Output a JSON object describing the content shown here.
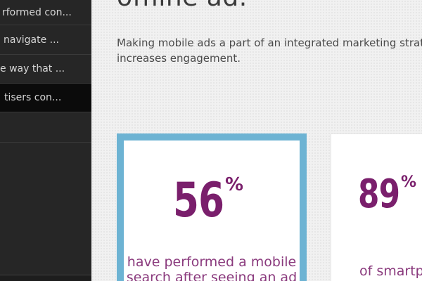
{
  "sidebar": {
    "items": [
      {
        "label": "rformed con..."
      },
      {
        "label": "navigate ..."
      },
      {
        "label": "e way that ..."
      },
      {
        "label": "tisers con...",
        "active": true
      },
      {
        "label": ""
      }
    ]
  },
  "main": {
    "headline": "offline ad.",
    "intro": "Making mobile ads a part of an integrated marketing strategy increases engagement.",
    "cards": [
      {
        "stat": "56",
        "suffix": "%",
        "desc_line1": "have performed a mobile",
        "desc_line2": "search after seeing an ad"
      },
      {
        "stat": "89",
        "suffix": "%",
        "desc_line1": "of smartph"
      }
    ]
  },
  "colors": {
    "accent_purple": "#7a1f6c",
    "card_border_blue": "#6db3d3",
    "sidebar_bg": "#262626"
  }
}
